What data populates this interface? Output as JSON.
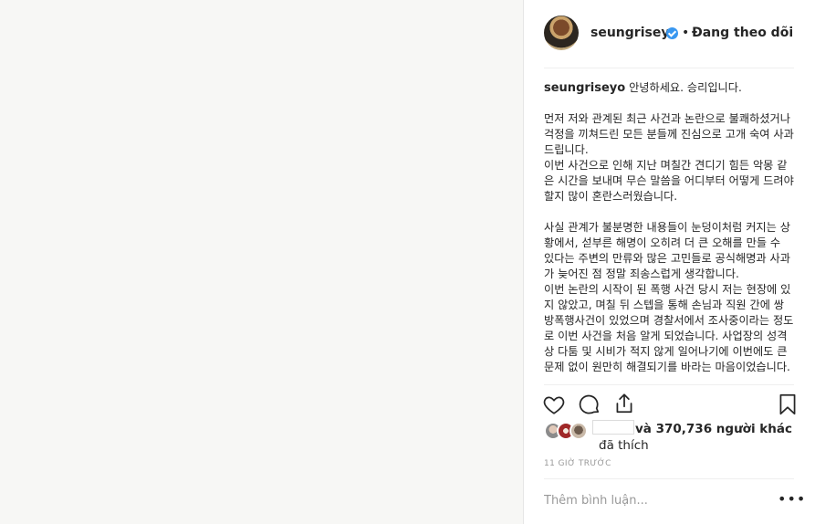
{
  "post": {
    "username": "seungriseyo",
    "separator": "•",
    "follow_status": "Đang theo dõi",
    "caption_greeting": "안녕하세요. 승리입니다.",
    "caption_body": "먼저 저와 관계된 최근 사건과 논란으로 불쾌하셨거나 걱정을 끼쳐드린 모든 분들께 진심으로 고개 숙여 사과드립니다.\n이번 사건으로 인해 지난 며칠간 견디기 힘든 악몽 같은 시간을 보내며 무슨 말씀을 어디부터 어떻게 드려야 할지 많이 혼란스러웠습니다.\n\n사실 관계가 불분명한 내용들이 눈덩이처럼 커지는 상황에서, 섣부른 해명이 오히려 더 큰 오해를 만들 수 있다는 주변의 만류와 많은 고민들로 공식해명과 사과가 늦어진 점 정말 죄송스럽게 생각합니다.\n이번 논란의 시작이 된 폭행 사건 당시 저는 현장에 있지 않았고, 며칠 뒤 스텝을 통해 손님과 직원 간에 쌍방폭행사건이 있었으며 경찰서에서 조사중이라는 정도로 이번 사건을 처음 알게 되었습니다. 사업장의 성격상 다툼 및 시비가 적지 않게 일어나기에 이번에도 큰 문제 없이 원만히 해결되기를 바라는 마음이었습니다."
  },
  "likes": {
    "text": "và 370,736 người khác",
    "liked_label": "đã thích"
  },
  "timestamp": "11 GIỜ TRƯỚC",
  "comment": {
    "placeholder": "Thêm bình luận..."
  },
  "more_label": "•••",
  "icons": {
    "like": "heart-icon",
    "comment": "comment-icon",
    "share": "share-icon",
    "save": "bookmark-icon",
    "verified": "verified-badge-icon",
    "more": "more-options-icon"
  },
  "colors": {
    "verified": "#3897f0",
    "text": "#262626",
    "muted": "#999999",
    "divider": "#efefef"
  }
}
